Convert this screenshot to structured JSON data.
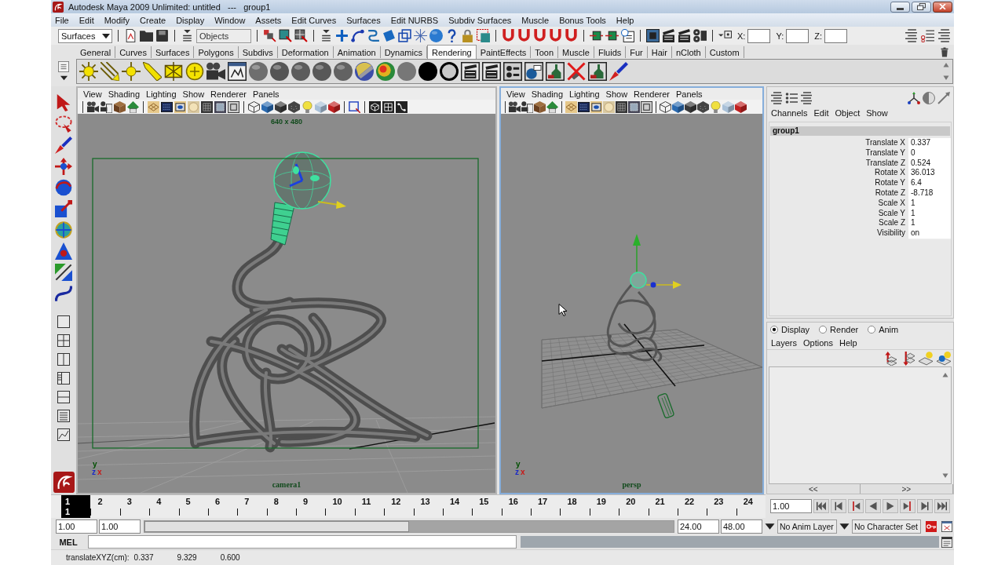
{
  "window": {
    "title": "Autodesk Maya 2009 Unlimited: untitled   ---   group1"
  },
  "menu_bar": [
    "File",
    "Edit",
    "Modify",
    "Create",
    "Display",
    "Window",
    "Assets",
    "Edit Curves",
    "Surfaces",
    "Edit NURBS",
    "Subdiv Surfaces",
    "Muscle",
    "Bonus Tools",
    "Help"
  ],
  "status_line": {
    "menu_set": "Surfaces",
    "selection_mask": "Objects",
    "input_labels": [
      "X:",
      "Y:",
      "Z:"
    ]
  },
  "shelf": {
    "tabs": [
      {
        "label": "General",
        "selected": false
      },
      {
        "label": "Curves",
        "selected": false
      },
      {
        "label": "Surfaces",
        "selected": false
      },
      {
        "label": "Polygons",
        "selected": false
      },
      {
        "label": "Subdivs",
        "selected": false
      },
      {
        "label": "Deformation",
        "selected": false
      },
      {
        "label": "Animation",
        "selected": false
      },
      {
        "label": "Dynamics",
        "selected": false
      },
      {
        "label": "Rendering",
        "selected": true
      },
      {
        "label": "PaintEffects",
        "selected": false
      },
      {
        "label": "Toon",
        "selected": false
      },
      {
        "label": "Muscle",
        "selected": false
      },
      {
        "label": "Fluids",
        "selected": false
      },
      {
        "label": "Fur",
        "selected": false
      },
      {
        "label": "Hair",
        "selected": false
      },
      {
        "label": "nCloth",
        "selected": false
      },
      {
        "label": "Custom",
        "selected": false
      }
    ]
  },
  "viewports": [
    {
      "kind": "camera_view",
      "active": false,
      "menu": [
        "View",
        "Shading",
        "Lighting",
        "Show",
        "Renderer",
        "Panels"
      ],
      "resolution": "640 x 480",
      "camera": "camera1",
      "axis_labels": [
        "y",
        "z",
        "x"
      ]
    },
    {
      "kind": "perspective_view",
      "active": true,
      "menu": [
        "View",
        "Shading",
        "Lighting",
        "Show",
        "Renderer",
        "Panels"
      ],
      "camera": "persp",
      "axis_labels": [
        "y",
        "z",
        "x"
      ]
    }
  ],
  "channel_box": {
    "menu": [
      "Channels",
      "Edit",
      "Object",
      "Show"
    ],
    "object": "group1",
    "channels": [
      {
        "name": "Translate X",
        "value": "0.337"
      },
      {
        "name": "Translate Y",
        "value": "0"
      },
      {
        "name": "Translate Z",
        "value": "0.524"
      },
      {
        "name": "Rotate X",
        "value": "36.013"
      },
      {
        "name": "Rotate Y",
        "value": "6.4"
      },
      {
        "name": "Rotate Z",
        "value": "-8.718"
      },
      {
        "name": "Scale X",
        "value": "1"
      },
      {
        "name": "Scale Y",
        "value": "1"
      },
      {
        "name": "Scale Z",
        "value": "1"
      },
      {
        "name": "Visibility",
        "value": "on"
      }
    ]
  },
  "layer_editor": {
    "modes": [
      {
        "label": "Display",
        "selected": true
      },
      {
        "label": "Render",
        "selected": false
      },
      {
        "label": "Anim",
        "selected": false
      }
    ],
    "menu": [
      "Layers",
      "Options",
      "Help"
    ],
    "scroll_buttons": [
      "<<",
      ">>"
    ]
  },
  "time_slider": {
    "frames": [
      {
        "label": "1",
        "selected": true
      },
      {
        "label": "2",
        "selected": false
      },
      {
        "label": "3",
        "selected": false
      },
      {
        "label": "4",
        "selected": false
      },
      {
        "label": "5",
        "selected": false
      },
      {
        "label": "6",
        "selected": false
      },
      {
        "label": "7",
        "selected": false
      },
      {
        "label": "8",
        "selected": false
      },
      {
        "label": "9",
        "selected": false
      },
      {
        "label": "10",
        "selected": false
      },
      {
        "label": "11",
        "selected": false
      },
      {
        "label": "12",
        "selected": false
      },
      {
        "label": "13",
        "selected": false
      },
      {
        "label": "14",
        "selected": false
      },
      {
        "label": "15",
        "selected": false
      },
      {
        "label": "16",
        "selected": false
      },
      {
        "label": "17",
        "selected": false
      },
      {
        "label": "18",
        "selected": false
      },
      {
        "label": "19",
        "selected": false
      },
      {
        "label": "20",
        "selected": false
      },
      {
        "label": "21",
        "selected": false
      },
      {
        "label": "22",
        "selected": false
      },
      {
        "label": "23",
        "selected": false
      },
      {
        "label": "24",
        "selected": false
      }
    ],
    "current_frame": "1",
    "current_time": "1.00"
  },
  "range_slider": {
    "start_time": "1.00",
    "range_start": "1.00",
    "range_end": "24.00",
    "end_time": "48.00",
    "level": 0.5
  },
  "anim_layer": "No Anim Layer",
  "character_set": "No Character Set",
  "command_line": {
    "language": "MEL"
  },
  "help_line": [
    "translateXYZ(cm):",
    "0.337",
    "9.329",
    "0.600"
  ]
}
